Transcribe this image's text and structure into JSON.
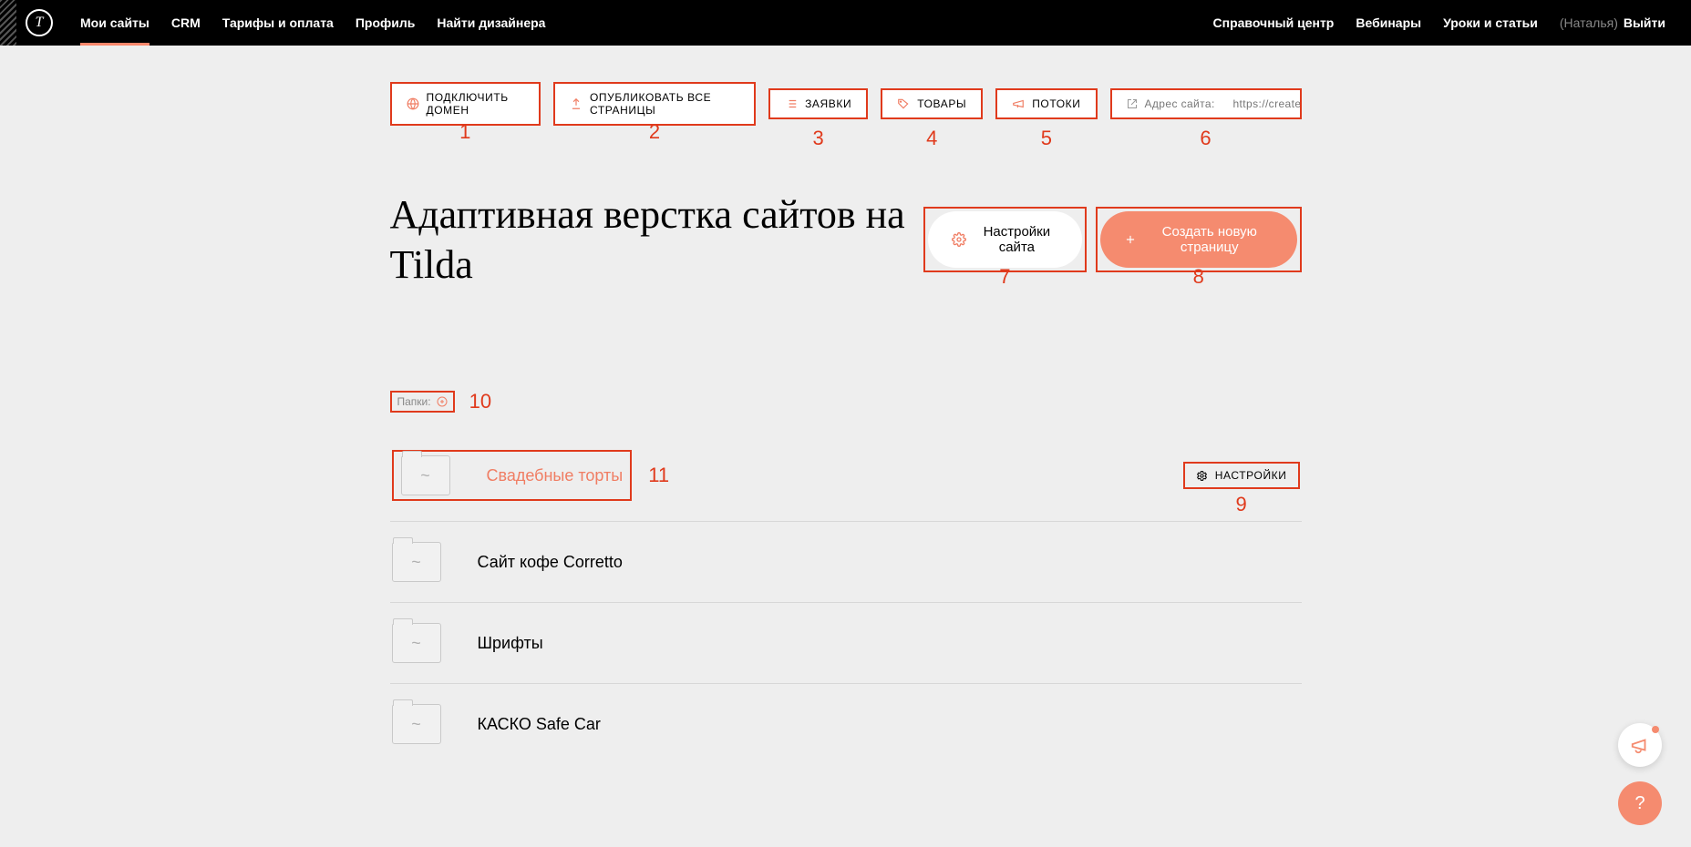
{
  "header": {
    "logo_glyph": "T",
    "nav_left": [
      {
        "label": "Мои сайты",
        "active": true
      },
      {
        "label": "CRM",
        "active": false
      },
      {
        "label": "Тарифы и оплата",
        "active": false
      },
      {
        "label": "Профиль",
        "active": false
      },
      {
        "label": "Найти дизайнера",
        "active": false
      }
    ],
    "nav_right": [
      {
        "label": "Справочный центр"
      },
      {
        "label": "Вебинары"
      },
      {
        "label": "Уроки и статьи"
      }
    ],
    "user_name": "(Наталья)",
    "logout": "Выйти"
  },
  "actions": {
    "connect_domain": "ПОДКЛЮЧИТЬ ДОМЕН",
    "publish_all": "ОПУБЛИКОВАТЬ ВСЕ СТРАНИЦЫ",
    "leads": "ЗАЯВКИ",
    "products": "ТОВАРЫ",
    "streams": "ПОТОКИ",
    "site_url_prefix": "Адрес сайта:",
    "site_url": "https://create-si…"
  },
  "annotations": {
    "n1": "1",
    "n2": "2",
    "n3": "3",
    "n4": "4",
    "n5": "5",
    "n6": "6",
    "n7": "7",
    "n8": "8",
    "n9": "9",
    "n10": "10",
    "n11": "11"
  },
  "title": "Адаптивная верстка сайтов на Tilda",
  "buttons": {
    "settings": "Настройки сайта",
    "new_page": "Создать новую страницу"
  },
  "folders_label": "Папки:",
  "folders": [
    {
      "name": "Свадебные торты",
      "active": true,
      "has_settings": true,
      "settings_label": "НАСТРОЙКИ"
    },
    {
      "name": "Сайт кофе Corretto",
      "active": false
    },
    {
      "name": "Шрифты",
      "active": false
    },
    {
      "name": "КАСКО Safe Car",
      "active": false
    }
  ],
  "float": {
    "announce_glyph": "",
    "help_glyph": "?"
  }
}
